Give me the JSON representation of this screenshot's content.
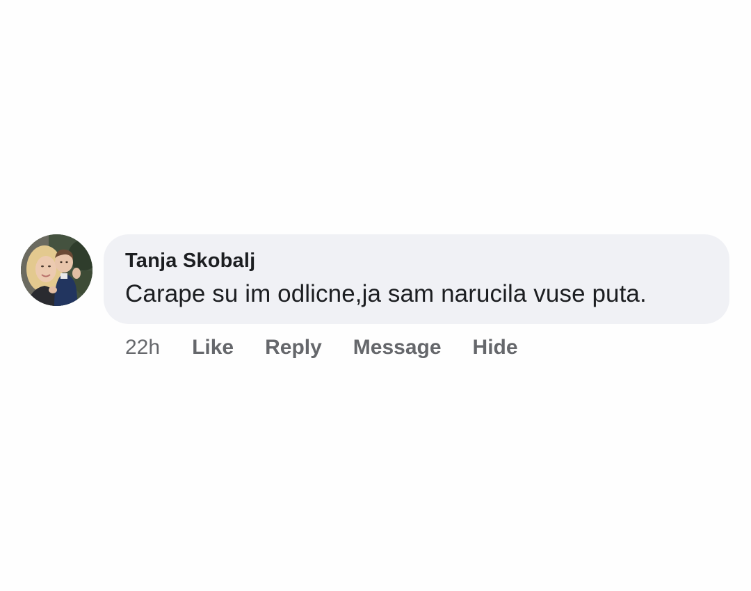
{
  "comment": {
    "author": "Tanja Skobalj",
    "text": "Carape su im odlicne,ja sam narucila vuse puta.",
    "timestamp": "22h",
    "actions": {
      "like": "Like",
      "reply": "Reply",
      "message": "Message",
      "hide": "Hide"
    },
    "avatar_icon": "profile-photo"
  },
  "colors": {
    "bubble": "#f0f1f5",
    "text": "#1c1e21",
    "secondary_text": "#65676b",
    "background": "#fefefe"
  }
}
